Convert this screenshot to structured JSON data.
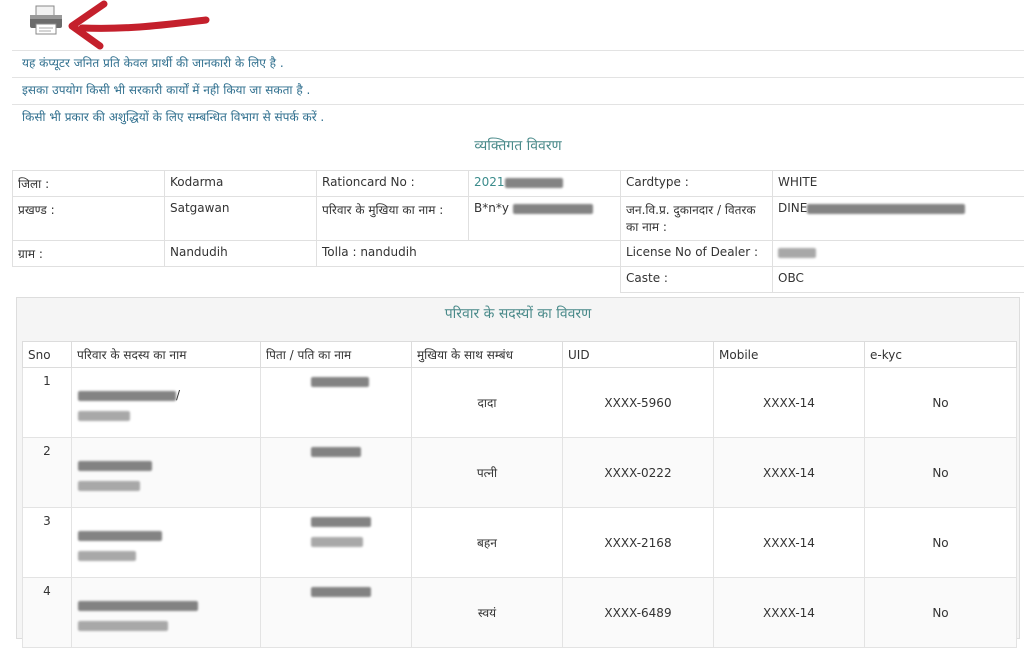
{
  "notices": [
    "यह कंप्यूटर जनित प्रति केवल प्रार्थी की जानकारी के लिए है .",
    "इसका उपयोग किसी भी सरकारी कार्यों में नही किया जा सकता है .",
    "किसी भी प्रकार की अशुद्धियों के लिए सम्बन्धित विभाग से संपर्क करें ."
  ],
  "personal": {
    "title": "व्यक्तिगत विवरण",
    "district_label": "जिला :",
    "district_value": "Kodarma",
    "rationcard_label": "Rationcard No :",
    "rationcard_value": "2021",
    "cardtype_label": "Cardtype :",
    "cardtype_value": "WHITE",
    "block_label": "प्रखण्ड :",
    "block_value": "Satgawan",
    "head_label": "परिवार के मुखिया का नाम :",
    "head_value": "B*n*y",
    "dealer_label": "जन.वि.प्र. दुकानदार / वितरक का नाम :",
    "dealer_value": "DINE",
    "village_label": "ग्राम :",
    "village_value": "Nandudih",
    "tolla": "Tolla : nandudih",
    "license_label": "License No of Dealer :",
    "caste_label": "Caste :",
    "caste_value": "OBC"
  },
  "members": {
    "title": "परिवार के सदस्यों का विवरण",
    "headers": [
      "Sno",
      "परिवार के सदस्य का नाम",
      "पिता / पति का नाम",
      "मुखिया के साथ सम्बंध",
      "UID",
      "Mobile",
      "e-kyc"
    ],
    "rows": [
      {
        "sno": "1",
        "relation": "दादा",
        "uid": "XXXX-5960",
        "mobile": "XXXX-14",
        "ekyc": "No",
        "suffix": "/"
      },
      {
        "sno": "2",
        "relation": "पत्नी",
        "uid": "XXXX-0222",
        "mobile": "XXXX-14",
        "ekyc": "No",
        "suffix": ""
      },
      {
        "sno": "3",
        "relation": "बहन",
        "uid": "XXXX-2168",
        "mobile": "XXXX-14",
        "ekyc": "No",
        "suffix": ""
      },
      {
        "sno": "4",
        "relation": "स्वयं",
        "uid": "XXXX-6489",
        "mobile": "XXXX-14",
        "ekyc": "No",
        "suffix": ""
      }
    ]
  },
  "icons": {
    "print": "printer-icon",
    "annotation": "red-arrow-annotation"
  }
}
